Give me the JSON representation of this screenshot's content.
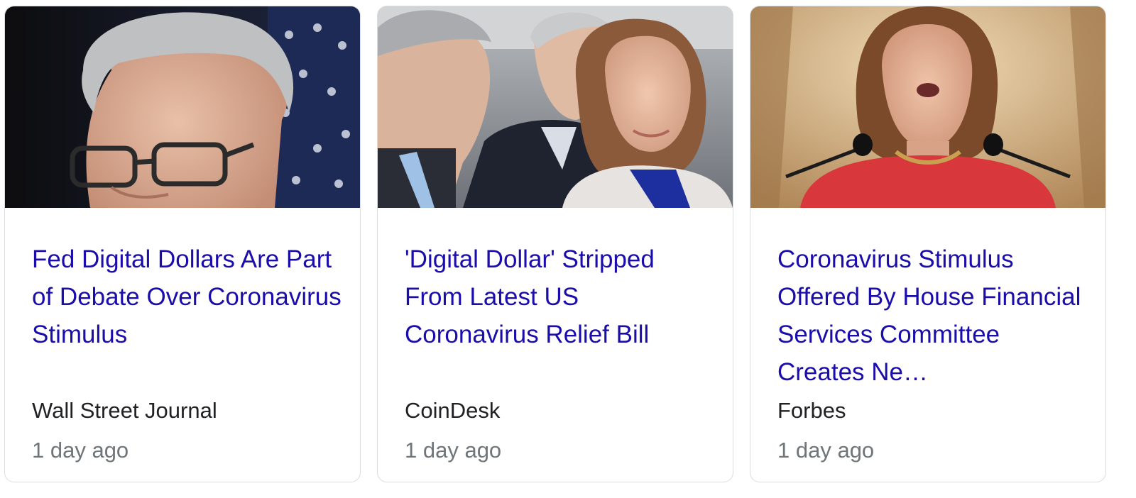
{
  "cards": [
    {
      "headline": "Fed Digital Dollars Are Part of Debate Over Coronavirus Stimulus",
      "source": "Wall Street Journal",
      "age": "1 day ago",
      "thumbnail": "photo of man with gray hair and glasses in front of flag"
    },
    {
      "headline": "'Digital Dollar' Stripped From Latest US Coronavirus Relief Bill",
      "source": "CoinDesk",
      "age": "1 day ago",
      "thumbnail": "photo of a group of politicians outdoors"
    },
    {
      "headline": "Coronavirus Stimulus Offered By House Financial Services Committee Creates Ne…",
      "source": "Forbes",
      "age": "1 day ago",
      "thumbnail": "photo of woman in red speaking at microphones"
    }
  ],
  "colors": {
    "headline": "#1a0dab",
    "source": "#202124",
    "age": "#70757a",
    "border": "#dadce0"
  }
}
